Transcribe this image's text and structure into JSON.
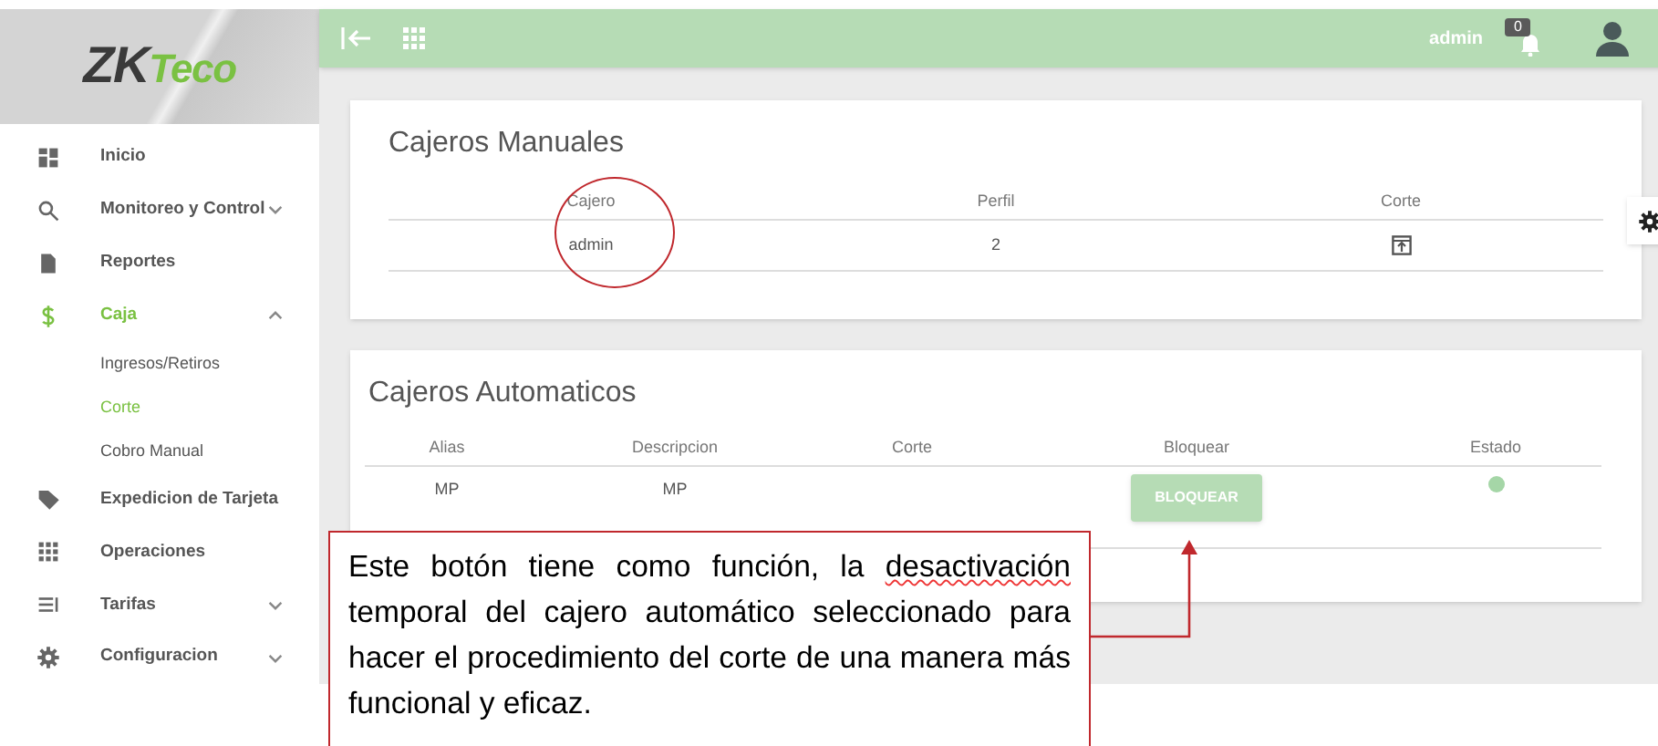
{
  "logo": {
    "part_1": "ZK",
    "part_2": "Teco"
  },
  "sidebar": {
    "items": [
      {
        "label": "Inicio",
        "selected": false
      },
      {
        "label": "Monitoreo y Control",
        "selected": false,
        "expanded": false
      },
      {
        "label": "Reportes",
        "selected": false
      },
      {
        "label": "Caja",
        "selected": true,
        "expanded": true,
        "children": [
          {
            "label": "Ingresos/Retiros",
            "selected": false
          },
          {
            "label": "Corte",
            "selected": true
          },
          {
            "label": "Cobro Manual",
            "selected": false
          }
        ]
      },
      {
        "label": "Expedicion de Tarjeta",
        "selected": false
      },
      {
        "label": "Operaciones",
        "selected": false
      },
      {
        "label": "Tarifas",
        "selected": false,
        "expanded": false
      },
      {
        "label": "Configuracion",
        "selected": false,
        "expanded": false
      }
    ]
  },
  "header": {
    "user": "admin",
    "notification_count": "0"
  },
  "manual_cashiers": {
    "title": "Cajeros Manuales",
    "columns": [
      "Cajero",
      "Perfil",
      "Corte"
    ],
    "rows": [
      {
        "cajero": "admin",
        "perfil": "2"
      }
    ]
  },
  "automatic_cashiers": {
    "title": "Cajeros Automaticos",
    "columns": [
      "Alias",
      "Descripcion",
      "Corte",
      "Bloquear",
      "Estado"
    ],
    "rows": [
      {
        "alias": "MP",
        "descripcion": "MP",
        "button": "BLOQUEAR",
        "color": "#a5d6a7"
      }
    ]
  },
  "callout": {
    "text_before": "Este botón tiene como función, la ",
    "flagged_word": "desactivación",
    "text_after": " temporal del cajero automático seleccionado para hacer el procedimiento del corte de una manera más funcional y eficaz."
  }
}
